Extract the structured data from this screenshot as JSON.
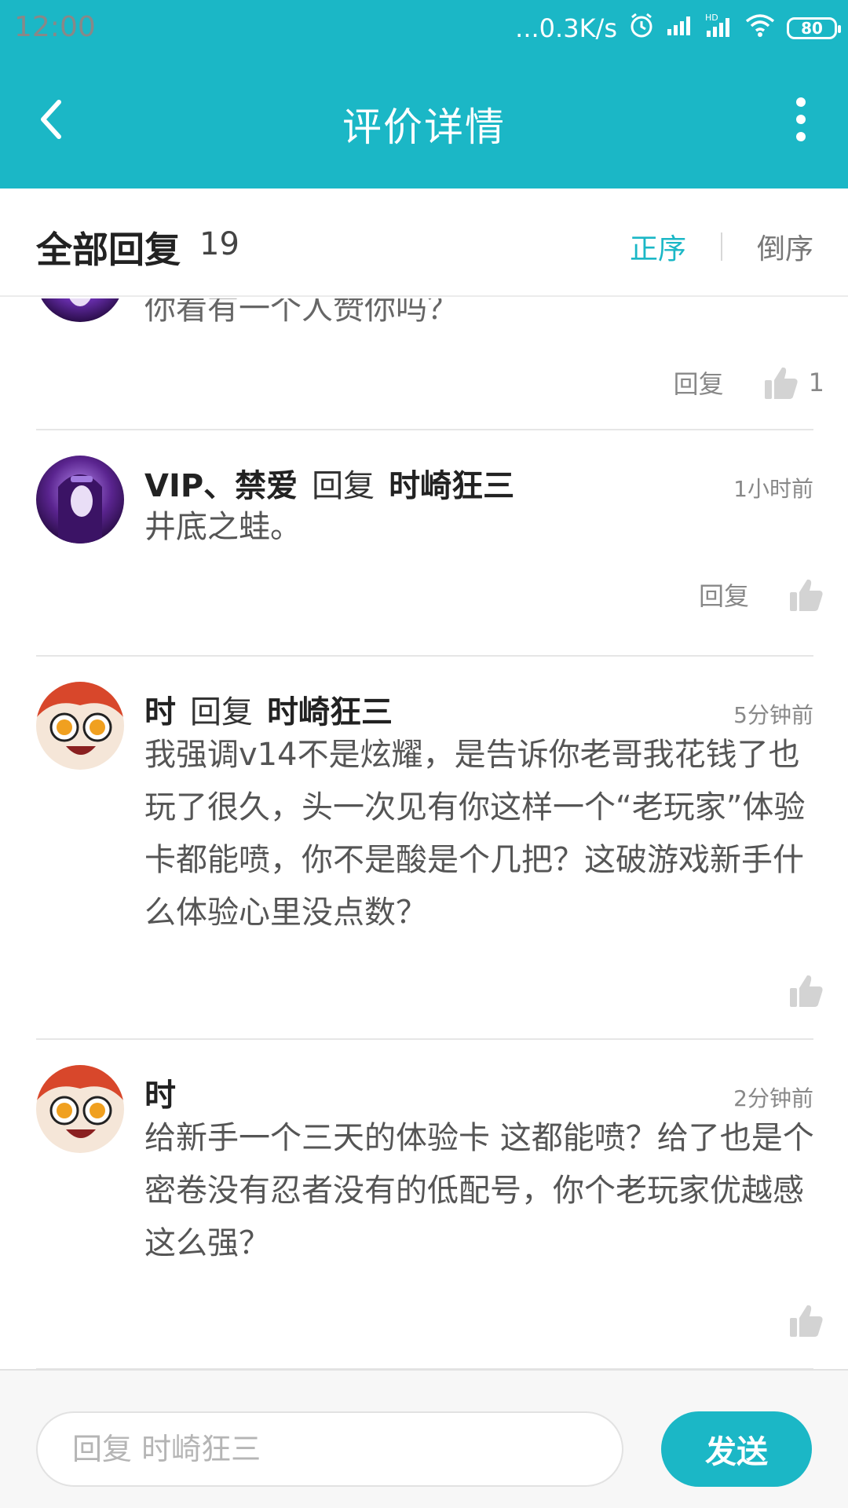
{
  "status_bar": {
    "time": "12:00",
    "net_speed": "...0.3K/s",
    "battery": "80"
  },
  "app_bar": {
    "title": "评价详情"
  },
  "replies_header": {
    "title": "全部回复",
    "count": "19",
    "sort_asc": "正序",
    "sort_desc": "倒序"
  },
  "replies": [
    {
      "content": "你看有一个人赞你吗？",
      "reply_label": "回复",
      "likes": "1"
    },
    {
      "username": "VIP、禁爱",
      "reply_word": "回复",
      "target": "时崎狂三",
      "time": "1小时前",
      "content": "井底之蛙。",
      "reply_label": "回复"
    },
    {
      "username": "时",
      "reply_word": "回复",
      "target": "时崎狂三",
      "time": "5分钟前",
      "content": "我强调v14不是炫耀，是告诉你老哥我花钱了也玩了很久，头一次见有你这样一个“老玩家”体验卡都能喷，你不是酸是个几把？这破游戏新手什么体验心里没点数？"
    },
    {
      "username": "时",
      "time": "2分钟前",
      "content": "给新手一个三天的体验卡 这都能喷？给了也是个密卷没有忍者没有的低配号，你个老玩家优越感这么强？"
    }
  ],
  "input_bar": {
    "placeholder": "回复 时崎狂三",
    "send_label": "发送"
  },
  "colors": {
    "accent": "#1bb7c6"
  },
  "icons": [
    "back-icon",
    "more-icon",
    "alarm-icon",
    "signal-icon",
    "wifi-icon",
    "thumbs-up-icon"
  ]
}
